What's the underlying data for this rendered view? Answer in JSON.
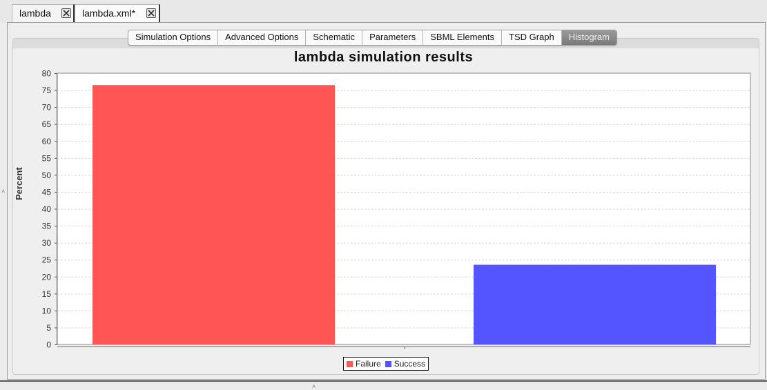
{
  "doc_tabs": [
    {
      "label": "lambda"
    },
    {
      "label": "lambda.xml*"
    }
  ],
  "tabs": [
    {
      "label": "Simulation Options"
    },
    {
      "label": "Advanced Options"
    },
    {
      "label": "Schematic"
    },
    {
      "label": "Parameters"
    },
    {
      "label": "SBML Elements"
    },
    {
      "label": "TSD Graph"
    },
    {
      "label": "Histogram",
      "active": true
    }
  ],
  "chart_data": {
    "type": "bar",
    "title": "lambda simulation results",
    "ylabel": "Percent",
    "xlabel": "",
    "ylim": [
      0,
      80
    ],
    "ytick_step": 5,
    "grid": true,
    "legend_position": "bottom",
    "series": [
      {
        "name": "Failure",
        "value": 76.5,
        "color": "#ff5555"
      },
      {
        "name": "Success",
        "value": 23.5,
        "color": "#5555ff"
      }
    ]
  }
}
